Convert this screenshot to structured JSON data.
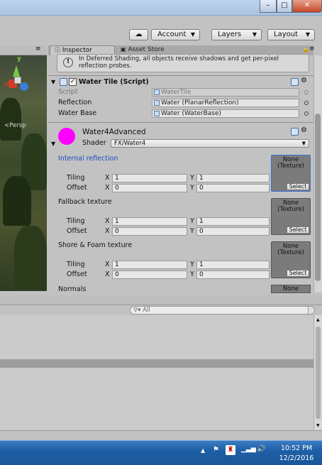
{
  "window_controls": {
    "minimize": "–",
    "maximize": "□",
    "close": "✕"
  },
  "toolbar": {
    "cloud_label": "",
    "account_label": "Account",
    "layers_label": "Layers",
    "layout_label": "Layout",
    "dropdown_glyph": "▼"
  },
  "scene": {
    "axis_y": "y",
    "axis_x": "x",
    "persp_label": "<Persp"
  },
  "inspector": {
    "tabs": {
      "inspector": "Inspector",
      "asset_store": "Asset Store",
      "lock": "🔒",
      "menu": "≡"
    },
    "help_text": "In Deferred Shading, all objects receive shadows and get per-pixel reflection probes.",
    "component": {
      "title": "Water Tile (Script)",
      "fields": [
        {
          "label": "Script",
          "value": "WaterTile"
        },
        {
          "label": "Reflection",
          "value": "Water (PlanarReflection)"
        },
        {
          "label": "Water Base",
          "value": "Water (WaterBase)"
        }
      ]
    },
    "material": {
      "name": "Water4Advanced",
      "color": "#ff00ff",
      "shader_label": "Shader",
      "shader_value": "FX/Water4",
      "textures": [
        {
          "title": "Internal reflection",
          "tiling_label": "Tiling",
          "offset_label": "Offset",
          "tiling_x": "1",
          "tiling_y": "1",
          "offset_x": "0",
          "offset_y": "0",
          "tex_name": "None\n(Texture)",
          "select": "Select",
          "highlight": true
        },
        {
          "title": "Fallback texture",
          "tiling_label": "Tiling",
          "offset_label": "Offset",
          "tiling_x": "1",
          "tiling_y": "1",
          "offset_x": "0",
          "offset_y": "0",
          "tex_name": "None\n(Texture)",
          "select": "Select",
          "highlight": false
        },
        {
          "title": "Shore & Foam texture",
          "tiling_label": "Tiling",
          "offset_label": "Offset",
          "tiling_x": "1",
          "tiling_y": "1",
          "offset_x": "0",
          "offset_y": "0",
          "tex_name": "None\n(Texture)",
          "select": "Select",
          "highlight": false
        }
      ],
      "normals_label": "Normals",
      "normals_tex": "None"
    },
    "axis_x": "X",
    "axis_y": "Y"
  },
  "console": {
    "search_placeholder": "All"
  },
  "taskbar": {
    "time": "10:52 PM",
    "date": "12/2/2016"
  },
  "colors": {
    "accent_link": "#1a4fc4",
    "taskbar": "#1e5fa6",
    "material_swatch": "#ff00ff"
  }
}
